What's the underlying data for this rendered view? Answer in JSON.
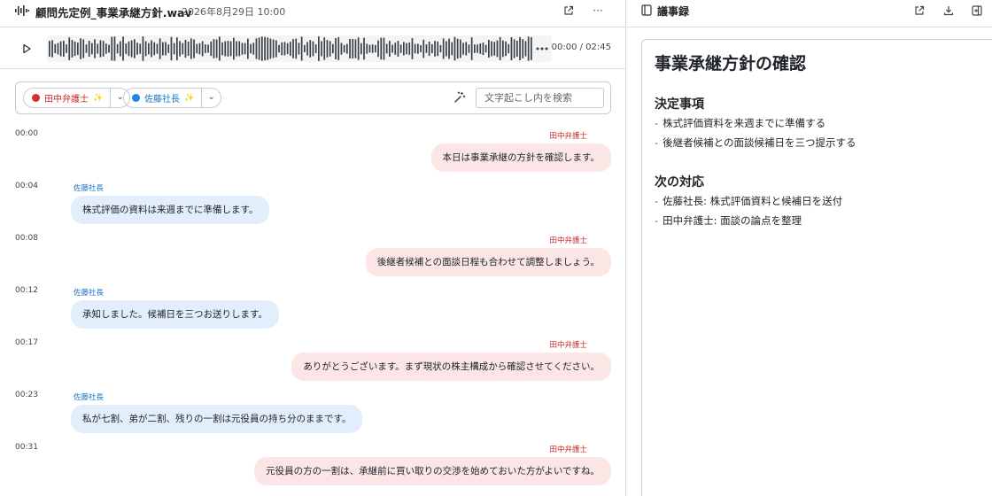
{
  "file": {
    "title": "顧問先定例_事業承継方針.wav",
    "date": "2026年8月29日 10:00",
    "more": "···"
  },
  "player": {
    "time": "00:00 / 02:45"
  },
  "speakers": [
    {
      "label": "田中弁護士",
      "spark": "✨",
      "chevron": "⌄",
      "color": "#d32f2f"
    },
    {
      "label": "佐藤社長",
      "spark": "✨",
      "chevron": "⌄",
      "color": "#1e88e5"
    }
  ],
  "search": {
    "placeholder": "文字起こし内を検索"
  },
  "transcript": [
    {
      "time": "00:00",
      "speaker": "田中弁護士",
      "side": "r",
      "text": "本日は事業承継の方針を確認します。"
    },
    {
      "time": "00:04",
      "speaker": "佐藤社長",
      "side": "l",
      "text": "株式評価の資料は来週までに準備します。"
    },
    {
      "time": "00:08",
      "speaker": "田中弁護士",
      "side": "r",
      "text": "後継者候補との面談日程も合わせて調整しましょう。"
    },
    {
      "time": "00:12",
      "speaker": "佐藤社長",
      "side": "l",
      "text": "承知しました。候補日を三つお送りします。"
    },
    {
      "time": "00:17",
      "speaker": "田中弁護士",
      "side": "r",
      "text": "ありがとうございます。まず現状の株主構成から確認させてください。"
    },
    {
      "time": "00:23",
      "speaker": "佐藤社長",
      "side": "l",
      "text": "私が七割、弟が二割、残りの一割は元役員の持ち分のままです。"
    },
    {
      "time": "00:31",
      "speaker": "田中弁護士",
      "side": "r",
      "text": "元役員の方の一割は、承継前に買い取りの交渉を始めておいた方がよいですね。"
    }
  ],
  "notes": {
    "header": "議事録",
    "title": "事業承継方針の確認",
    "sections": [
      {
        "heading": "決定事項",
        "items": [
          "株式評価資料を来週までに準備する",
          "後継者候補との面談候補日を三つ提示する"
        ]
      },
      {
        "heading": "次の対応",
        "items": [
          "佐藤社長: 株式評価資料と候補日を送付",
          "田中弁護士: 面談の論点を整理"
        ]
      }
    ],
    "bullet": "-"
  }
}
